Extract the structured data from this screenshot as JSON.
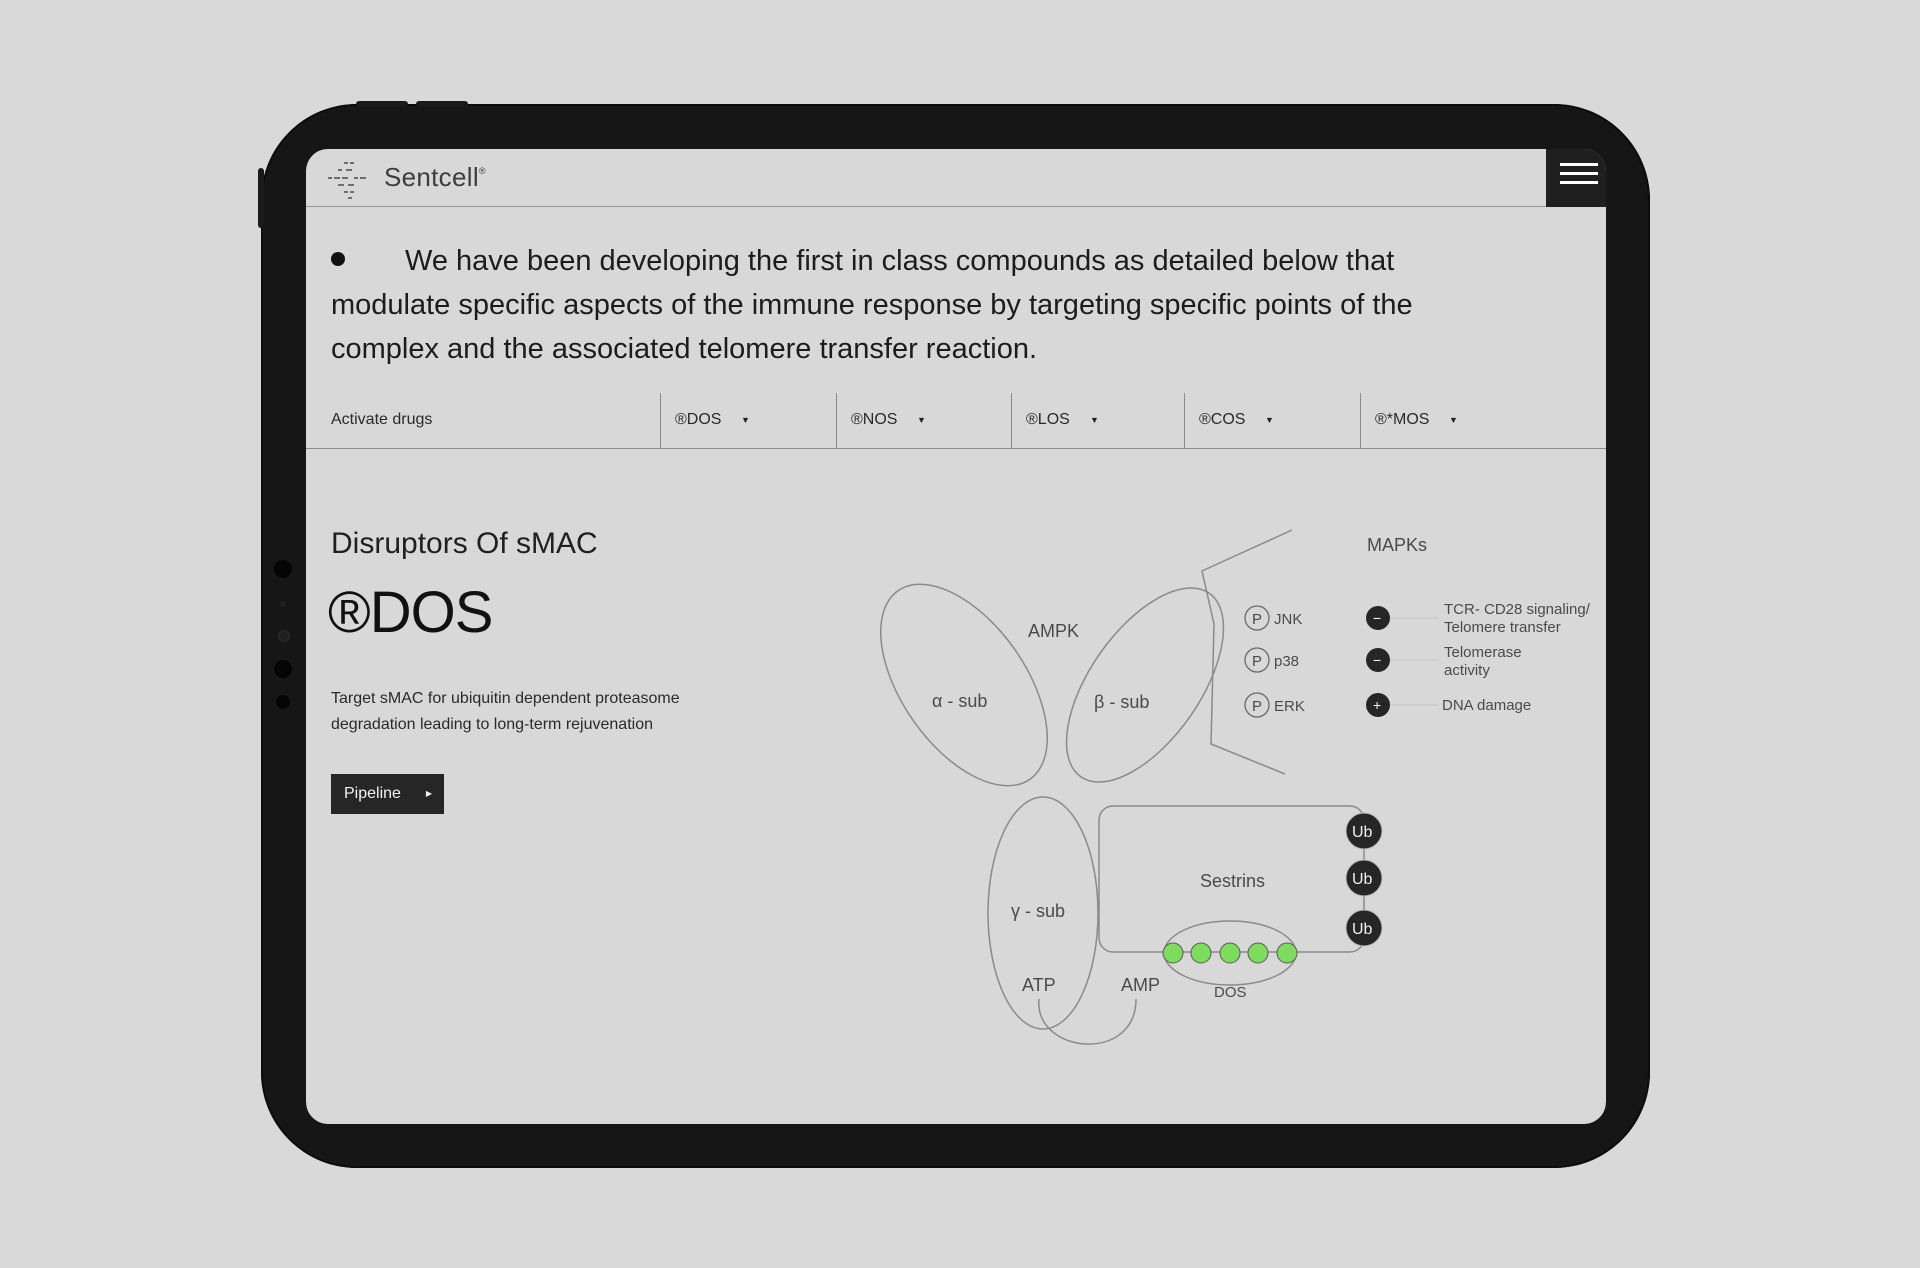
{
  "header": {
    "brand": "Sentcell",
    "brand_mark": "®",
    "menu_icon": "hamburger-icon"
  },
  "intro": {
    "text": "We have been developing the first in class compounds as detailed below that modulate specific aspects of the immune response by targeting specific points of the complex and the associated telomere transfer reaction."
  },
  "tabs": {
    "label": "Activate drugs",
    "items": [
      {
        "label": "®DOS"
      },
      {
        "label": "®NOS"
      },
      {
        "label": "®LOS"
      },
      {
        "label": "®COS"
      },
      {
        "label": "®*MOS"
      }
    ]
  },
  "product": {
    "subtitle": "Disruptors Of sMAC",
    "name": "®DOS",
    "description": "Target sMAC for ubiquitin dependent proteasome degradation leading to long-term rejuvenation",
    "button": "Pipeline"
  },
  "diagram": {
    "ampk": "AMPK",
    "alpha": "α - sub",
    "beta": "β - sub",
    "gamma": "γ - sub",
    "atp": "ATP",
    "amp": "AMP",
    "mapks": "MAPKs",
    "p_symbol": "P",
    "kinases": [
      {
        "name": "JNK",
        "sign": "−",
        "effect_line1": "TCR- CD28 signaling/",
        "effect_line2": "Telomere transfer"
      },
      {
        "name": "p38",
        "sign": "−",
        "effect_line1": "Telomerase",
        "effect_line2": "activity"
      },
      {
        "name": "ERK",
        "sign": "+",
        "effect_line1": "DNA damage",
        "effect_line2": ""
      }
    ],
    "sestrins": "Sestrins",
    "ub": [
      "Ub",
      "Ub",
      "Ub"
    ],
    "dos": "DOS",
    "dos_dot_color": "#7ddb5e"
  }
}
